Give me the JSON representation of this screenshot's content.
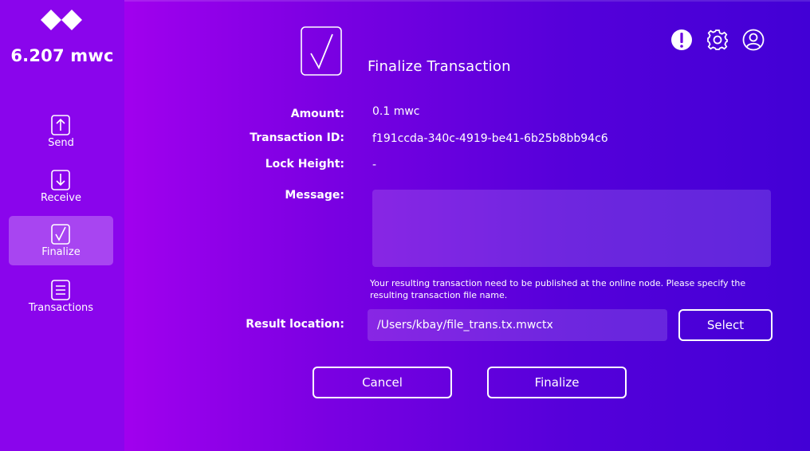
{
  "sidebar": {
    "balance": "6.207 mwc",
    "items": [
      {
        "label": "Send",
        "icon": "send-icon"
      },
      {
        "label": "Receive",
        "icon": "receive-icon"
      },
      {
        "label": "Finalize",
        "icon": "finalize-icon",
        "active": true
      },
      {
        "label": "Transactions",
        "icon": "transactions-icon"
      }
    ]
  },
  "header": {
    "icons": [
      "alert-icon",
      "settings-gear-icon",
      "account-icon"
    ]
  },
  "page": {
    "title": "Finalize Transaction",
    "icon": "checkbox-icon"
  },
  "fields": {
    "amount_label": "Amount:",
    "amount_value": "0.1 mwc",
    "txid_label": "Transaction ID:",
    "txid_value": "f191ccda-340c-4919-be41-6b25b8bb94c6",
    "lock_label": "Lock Height:",
    "lock_value": "-",
    "message_label": "Message:",
    "message_value": "",
    "hint": "Your resulting transaction need to be published at the online node. Please specify the resulting transaction file name.",
    "result_label": "Result location:",
    "result_value": "/Users/kbay/file_trans.tx.mwctx"
  },
  "buttons": {
    "select": "Select",
    "cancel": "Cancel",
    "finalize": "Finalize"
  },
  "colors": {
    "sidebar": "#8a05ec",
    "gradient_start": "#a100ee",
    "gradient_end": "#4200d6"
  }
}
